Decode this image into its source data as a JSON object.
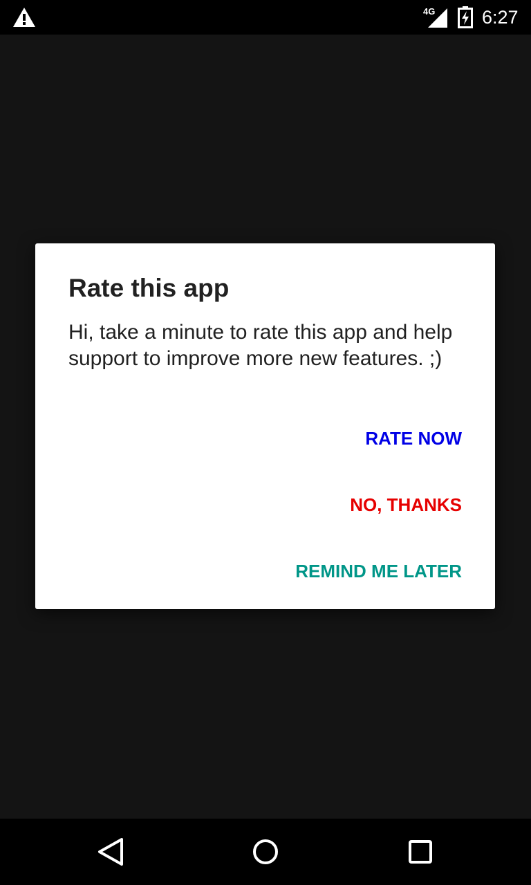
{
  "status_bar": {
    "network_type": "4G",
    "time": "6:27",
    "icons": [
      "warning-icon",
      "signal-icon",
      "battery-charging-icon"
    ]
  },
  "dialog": {
    "title": "Rate this app",
    "message": "Hi, take a minute to rate this app and help support to improve more new features. ;)",
    "buttons": {
      "rate_now": {
        "label": "RATE NOW",
        "color": "#0000e6"
      },
      "no_thanks": {
        "label": "NO, THANKS",
        "color": "#e60000"
      },
      "remind_later": {
        "label": "REMIND ME LATER",
        "color": "#009688"
      }
    }
  },
  "nav_bar": {
    "icons": [
      "back-icon",
      "home-icon",
      "recent-apps-icon"
    ]
  },
  "colors": {
    "background": "#141414",
    "status_bar": "#000000",
    "dialog": "#ffffff",
    "text": "#212121"
  }
}
